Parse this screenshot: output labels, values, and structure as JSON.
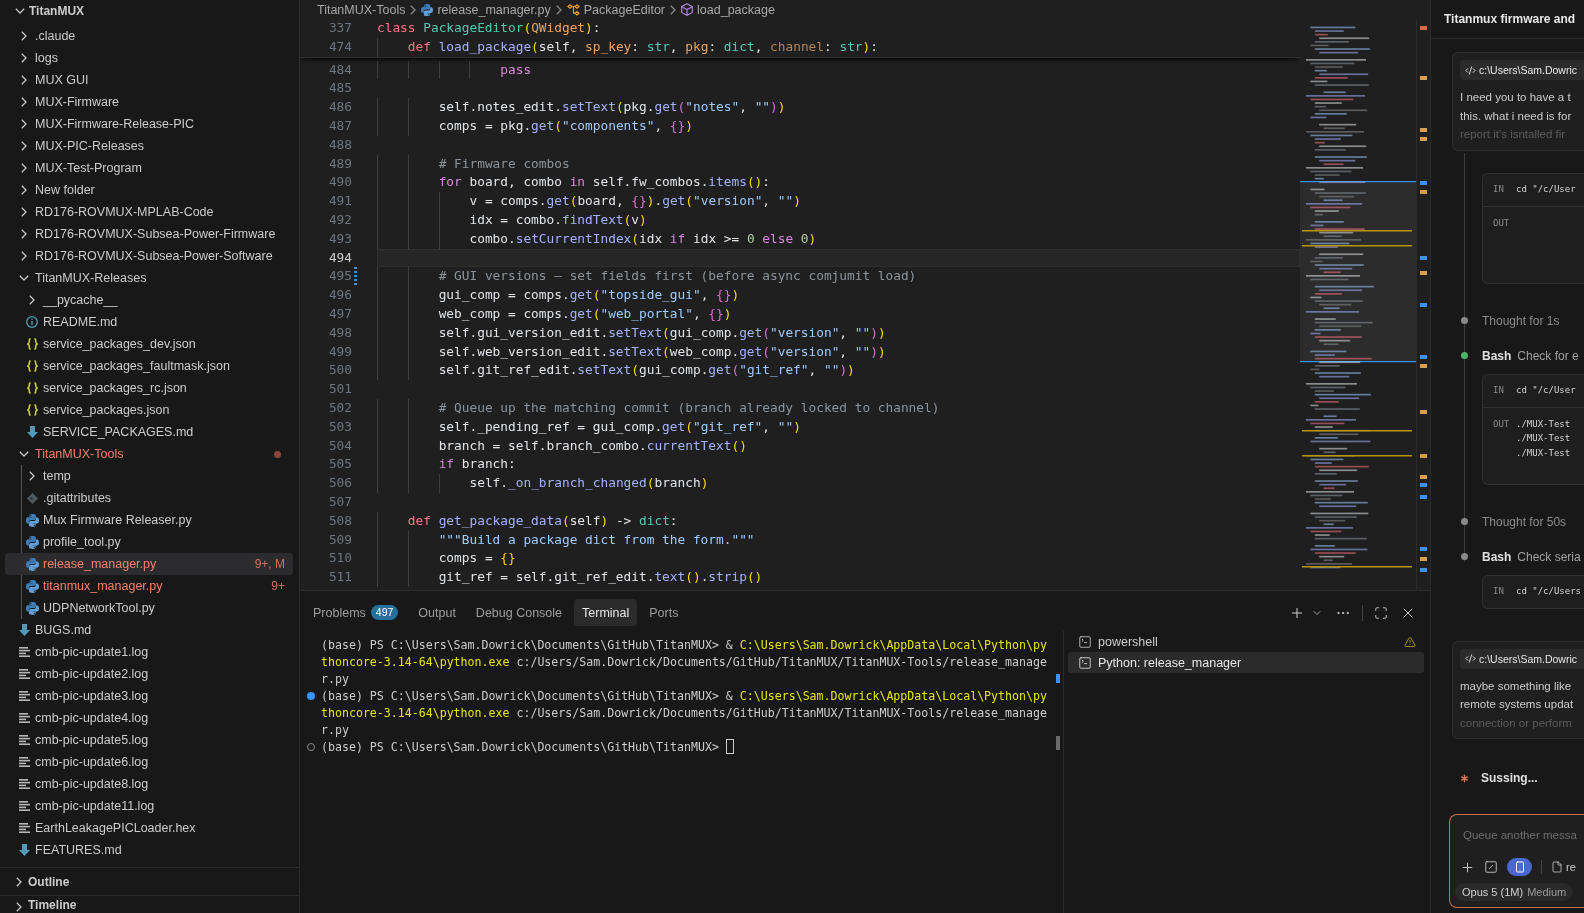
{
  "explorer": {
    "root": {
      "label": "TitanMUX",
      "expanded": true,
      "children": [
        {
          "label": ".claude",
          "kind": "folder",
          "expanded": false,
          "selected": false,
          "problem": false,
          "dot": false
        },
        {
          "label": "logs",
          "kind": "folder",
          "expanded": false,
          "selected": false,
          "problem": false,
          "dot": false
        },
        {
          "label": "MUX GUI",
          "kind": "folder",
          "expanded": false,
          "selected": false,
          "problem": false,
          "dot": false
        },
        {
          "label": "MUX-Firmware",
          "kind": "folder",
          "expanded": false,
          "selected": false,
          "problem": false,
          "dot": false
        },
        {
          "label": "MUX-Firmware-Release-PIC",
          "kind": "folder",
          "expanded": false,
          "selected": false,
          "problem": false,
          "dot": false
        },
        {
          "label": "MUX-PIC-Releases",
          "kind": "folder",
          "expanded": false,
          "selected": false,
          "problem": false,
          "dot": false
        },
        {
          "label": "MUX-Test-Program",
          "kind": "folder",
          "expanded": false,
          "selected": false,
          "problem": false,
          "dot": false
        },
        {
          "label": "New folder",
          "kind": "folder",
          "expanded": false,
          "selected": false,
          "problem": false,
          "dot": false
        },
        {
          "label": "RD176-ROVMUX-MPLAB-Code",
          "kind": "folder",
          "expanded": false,
          "selected": false,
          "problem": false,
          "dot": false
        },
        {
          "label": "RD176-ROVMUX-Subsea-Power-Firmware",
          "kind": "folder",
          "expanded": false,
          "selected": false,
          "problem": false,
          "dot": false
        },
        {
          "label": "RD176-ROVMUX-Subsea-Power-Software",
          "kind": "folder",
          "expanded": false,
          "selected": false,
          "problem": false,
          "dot": false
        },
        {
          "label": "TitanMUX-Releases",
          "kind": "folder",
          "expanded": true,
          "selected": false,
          "problem": false,
          "dot": false,
          "children": [
            {
              "label": "__pycache__",
              "kind": "folder",
              "expanded": false,
              "selected": false,
              "problem": false,
              "dot": false
            },
            {
              "label": "README.md",
              "kind": "readme",
              "selected": false,
              "problem": false
            },
            {
              "label": "service_packages_dev.json",
              "kind": "json",
              "selected": false,
              "problem": false
            },
            {
              "label": "service_packages_faultmask.json",
              "kind": "json",
              "selected": false,
              "problem": false
            },
            {
              "label": "service_packages_rc.json",
              "kind": "json",
              "selected": false,
              "problem": false
            },
            {
              "label": "service_packages.json",
              "kind": "json",
              "selected": false,
              "problem": false
            },
            {
              "label": "SERVICE_PACKAGES.md",
              "kind": "markdown",
              "selected": false,
              "problem": false
            }
          ]
        },
        {
          "label": "TitanMUX-Tools",
          "kind": "folder",
          "expanded": true,
          "selected": false,
          "problem": true,
          "dot": true,
          "children": [
            {
              "label": "temp",
              "kind": "folder",
              "expanded": false,
              "selected": false,
              "problem": false,
              "dot": false
            },
            {
              "label": ".gitattributes",
              "kind": "git",
              "selected": false,
              "problem": false
            },
            {
              "label": "Mux Firmware Releaser.py",
              "kind": "python",
              "selected": false,
              "problem": false
            },
            {
              "label": "profile_tool.py",
              "kind": "python",
              "selected": false,
              "problem": false
            },
            {
              "label": "release_manager.py",
              "kind": "python",
              "selected": true,
              "problem": true,
              "badge": "9+, M"
            },
            {
              "label": "titanmux_manager.py",
              "kind": "python",
              "selected": false,
              "problem": true,
              "badge": "9+"
            },
            {
              "label": "UDPNetworkTool.py",
              "kind": "python",
              "selected": false,
              "problem": false
            }
          ]
        },
        {
          "label": "BUGS.md",
          "kind": "markdown",
          "selected": false,
          "problem": false
        },
        {
          "label": "cmb-pic-update1.log",
          "kind": "text",
          "selected": false,
          "problem": false
        },
        {
          "label": "cmb-pic-update2.log",
          "kind": "text",
          "selected": false,
          "problem": false
        },
        {
          "label": "cmb-pic-update3.log",
          "kind": "text",
          "selected": false,
          "problem": false
        },
        {
          "label": "cmb-pic-update4.log",
          "kind": "text",
          "selected": false,
          "problem": false
        },
        {
          "label": "cmb-pic-update5.log",
          "kind": "text",
          "selected": false,
          "problem": false
        },
        {
          "label": "cmb-pic-update6.log",
          "kind": "text",
          "selected": false,
          "problem": false
        },
        {
          "label": "cmb-pic-update8.log",
          "kind": "text",
          "selected": false,
          "problem": false
        },
        {
          "label": "cmb-pic-update11.log",
          "kind": "text",
          "selected": false,
          "problem": false
        },
        {
          "label": "EarthLeakagePICLoader.hex",
          "kind": "text",
          "selected": false,
          "problem": false
        },
        {
          "label": "FEATURES.md",
          "kind": "markdown",
          "selected": false,
          "problem": false
        }
      ]
    },
    "sections": [
      {
        "label": "Outline",
        "expanded": false
      },
      {
        "label": "Timeline",
        "expanded": false
      }
    ]
  },
  "editor": {
    "breadcrumbs": [
      {
        "label": "TitanMUX-Tools",
        "kind": "folder"
      },
      {
        "label": "release_manager.py",
        "kind": "python"
      },
      {
        "label": "PackageEditor",
        "kind": "class"
      },
      {
        "label": "load_package",
        "kind": "method"
      }
    ],
    "sticky_lines": [
      {
        "number": "337",
        "tokens": [
          {
            "kind": "keyword",
            "text": "class "
          },
          {
            "kind": "class-name",
            "text": "PackageEditor"
          },
          {
            "kind": "bracket-1",
            "text": "("
          },
          {
            "kind": "base-class",
            "text": "QWidget"
          },
          {
            "kind": "bracket-1",
            "text": ")"
          },
          {
            "kind": "plain",
            "text": ":"
          }
        ]
      },
      {
        "number": "474",
        "tokens": [
          {
            "kind": "keyword",
            "text": "    def "
          },
          {
            "kind": "function",
            "text": "load_package"
          },
          {
            "kind": "bracket-1",
            "text": "("
          },
          {
            "kind": "plain",
            "text": "self, "
          },
          {
            "kind": "parameter",
            "text": "sp_key"
          },
          {
            "kind": "plain",
            "text": ": "
          },
          {
            "kind": "type",
            "text": "str"
          },
          {
            "kind": "plain",
            "text": ", "
          },
          {
            "kind": "parameter",
            "text": "pkg"
          },
          {
            "kind": "plain",
            "text": ": "
          },
          {
            "kind": "type",
            "text": "dict"
          },
          {
            "kind": "plain",
            "text": ", "
          },
          {
            "kind": "unused-parameter",
            "text": "channel"
          },
          {
            "kind": "plain",
            "text": ": "
          },
          {
            "kind": "type",
            "text": "str"
          },
          {
            "kind": "bracket-1",
            "text": ")"
          },
          {
            "kind": "plain",
            "text": ":"
          }
        ]
      }
    ],
    "lines": [
      {
        "number": "484",
        "current": false,
        "changed": false,
        "tokens": [
          {
            "kind": "control",
            "text": "                pass"
          }
        ]
      },
      {
        "number": "485",
        "current": false,
        "changed": false
      },
      {
        "number": "486",
        "current": false,
        "changed": false,
        "tokens": [
          {
            "kind": "plain",
            "text": "        self.notes_edit."
          },
          {
            "kind": "function",
            "text": "setText"
          },
          {
            "kind": "bracket-1",
            "text": "("
          },
          {
            "kind": "plain",
            "text": "pkg."
          },
          {
            "kind": "function",
            "text": "get"
          },
          {
            "kind": "bracket-2",
            "text": "("
          },
          {
            "kind": "string",
            "text": "\"notes\""
          },
          {
            "kind": "plain",
            "text": ", "
          },
          {
            "kind": "string",
            "text": "\"\""
          },
          {
            "kind": "bracket-2",
            "text": ")"
          },
          {
            "kind": "bracket-1",
            "text": ")"
          }
        ]
      },
      {
        "number": "487",
        "current": false,
        "changed": false,
        "tokens": [
          {
            "kind": "plain",
            "text": "        comps = pkg."
          },
          {
            "kind": "function",
            "text": "get"
          },
          {
            "kind": "bracket-1",
            "text": "("
          },
          {
            "kind": "string",
            "text": "\"components\""
          },
          {
            "kind": "plain",
            "text": ", "
          },
          {
            "kind": "bracket-2",
            "text": "{}"
          },
          {
            "kind": "bracket-1",
            "text": ")"
          }
        ]
      },
      {
        "number": "488",
        "current": false,
        "changed": false
      },
      {
        "number": "489",
        "current": false,
        "changed": false,
        "tokens": [
          {
            "kind": "comment",
            "text": "        # Firmware combos"
          }
        ]
      },
      {
        "number": "490",
        "current": false,
        "changed": false,
        "tokens": [
          {
            "kind": "control",
            "text": "        for"
          },
          {
            "kind": "plain",
            "text": " board, combo "
          },
          {
            "kind": "control",
            "text": "in"
          },
          {
            "kind": "plain",
            "text": " self.fw_combos."
          },
          {
            "kind": "function",
            "text": "items"
          },
          {
            "kind": "bracket-1",
            "text": "()"
          },
          {
            "kind": "plain",
            "text": ":"
          }
        ]
      },
      {
        "number": "491",
        "current": false,
        "changed": false,
        "tokens": [
          {
            "kind": "plain",
            "text": "            v = comps."
          },
          {
            "kind": "function",
            "text": "get"
          },
          {
            "kind": "bracket-1",
            "text": "("
          },
          {
            "kind": "plain",
            "text": "board, "
          },
          {
            "kind": "bracket-2",
            "text": "{}"
          },
          {
            "kind": "bracket-1",
            "text": ")"
          },
          {
            "kind": "plain",
            "text": "."
          },
          {
            "kind": "function",
            "text": "get"
          },
          {
            "kind": "bracket-1",
            "text": "("
          },
          {
            "kind": "string",
            "text": "\"version\""
          },
          {
            "kind": "plain",
            "text": ", "
          },
          {
            "kind": "string",
            "text": "\"\""
          },
          {
            "kind": "bracket-1",
            "text": ")"
          }
        ]
      },
      {
        "number": "492",
        "current": false,
        "changed": false,
        "tokens": [
          {
            "kind": "plain",
            "text": "            idx = combo."
          },
          {
            "kind": "function",
            "text": "findText"
          },
          {
            "kind": "bracket-1",
            "text": "("
          },
          {
            "kind": "plain",
            "text": "v"
          },
          {
            "kind": "bracket-1",
            "text": ")"
          }
        ]
      },
      {
        "number": "493",
        "current": false,
        "changed": false,
        "tokens": [
          {
            "kind": "plain",
            "text": "            combo."
          },
          {
            "kind": "function",
            "text": "setCurrentIndex"
          },
          {
            "kind": "bracket-1",
            "text": "("
          },
          {
            "kind": "plain",
            "text": "idx "
          },
          {
            "kind": "control",
            "text": "if"
          },
          {
            "kind": "plain",
            "text": " idx >= "
          },
          {
            "kind": "number",
            "text": "0 "
          },
          {
            "kind": "control",
            "text": "else "
          },
          {
            "kind": "number",
            "text": "0"
          },
          {
            "kind": "bracket-1",
            "text": ")"
          }
        ]
      },
      {
        "number": "494",
        "current": true,
        "changed": false
      },
      {
        "number": "495",
        "current": false,
        "changed": true,
        "tokens": [
          {
            "kind": "comment",
            "text": "        # GUI versions — set fields first (before async comjumit load)"
          }
        ]
      },
      {
        "number": "496",
        "current": false,
        "changed": false,
        "tokens": [
          {
            "kind": "plain",
            "text": "        gui_comp = comps."
          },
          {
            "kind": "function",
            "text": "get"
          },
          {
            "kind": "bracket-1",
            "text": "("
          },
          {
            "kind": "string",
            "text": "\"topside_gui\""
          },
          {
            "kind": "plain",
            "text": ", "
          },
          {
            "kind": "bracket-2",
            "text": "{}"
          },
          {
            "kind": "bracket-1",
            "text": ")"
          }
        ]
      },
      {
        "number": "497",
        "current": false,
        "changed": false,
        "tokens": [
          {
            "kind": "plain",
            "text": "        web_comp = comps."
          },
          {
            "kind": "function",
            "text": "get"
          },
          {
            "kind": "bracket-1",
            "text": "("
          },
          {
            "kind": "string",
            "text": "\"web_portal\""
          },
          {
            "kind": "plain",
            "text": ", "
          },
          {
            "kind": "bracket-2",
            "text": "{}"
          },
          {
            "kind": "bracket-1",
            "text": ")"
          }
        ]
      },
      {
        "number": "498",
        "current": false,
        "changed": false,
        "tokens": [
          {
            "kind": "plain",
            "text": "        self.gui_version_edit."
          },
          {
            "kind": "function",
            "text": "setText"
          },
          {
            "kind": "bracket-1",
            "text": "("
          },
          {
            "kind": "plain",
            "text": "gui_comp."
          },
          {
            "kind": "function",
            "text": "get"
          },
          {
            "kind": "bracket-2",
            "text": "("
          },
          {
            "kind": "string",
            "text": "\"version\""
          },
          {
            "kind": "plain",
            "text": ", "
          },
          {
            "kind": "string",
            "text": "\"\""
          },
          {
            "kind": "bracket-2",
            "text": ")"
          },
          {
            "kind": "bracket-1",
            "text": ")"
          }
        ]
      },
      {
        "number": "499",
        "current": false,
        "changed": false,
        "tokens": [
          {
            "kind": "plain",
            "text": "        self.web_version_edit."
          },
          {
            "kind": "function",
            "text": "setText"
          },
          {
            "kind": "bracket-1",
            "text": "("
          },
          {
            "kind": "plain",
            "text": "web_comp."
          },
          {
            "kind": "function",
            "text": "get"
          },
          {
            "kind": "bracket-2",
            "text": "("
          },
          {
            "kind": "string",
            "text": "\"version\""
          },
          {
            "kind": "plain",
            "text": ", "
          },
          {
            "kind": "string",
            "text": "\"\""
          },
          {
            "kind": "bracket-2",
            "text": ")"
          },
          {
            "kind": "bracket-1",
            "text": ")"
          }
        ]
      },
      {
        "number": "500",
        "current": false,
        "changed": false,
        "tokens": [
          {
            "kind": "plain",
            "text": "        self.git_ref_edit."
          },
          {
            "kind": "function",
            "text": "setText"
          },
          {
            "kind": "bracket-1",
            "text": "("
          },
          {
            "kind": "plain",
            "text": "gui_comp."
          },
          {
            "kind": "function",
            "text": "get"
          },
          {
            "kind": "bracket-2",
            "text": "("
          },
          {
            "kind": "string",
            "text": "\"git_ref\""
          },
          {
            "kind": "plain",
            "text": ", "
          },
          {
            "kind": "string",
            "text": "\"\""
          },
          {
            "kind": "bracket-2",
            "text": ")"
          },
          {
            "kind": "bracket-1",
            "text": ")"
          }
        ]
      },
      {
        "number": "501",
        "current": false,
        "changed": false
      },
      {
        "number": "502",
        "current": false,
        "changed": false,
        "tokens": [
          {
            "kind": "comment",
            "text": "        # Queue up the matching commit (branch already locked to channel)"
          }
        ]
      },
      {
        "number": "503",
        "current": false,
        "changed": false,
        "tokens": [
          {
            "kind": "plain",
            "text": "        self._pending_ref = gui_comp."
          },
          {
            "kind": "function",
            "text": "get"
          },
          {
            "kind": "bracket-1",
            "text": "("
          },
          {
            "kind": "string",
            "text": "\"git_ref\""
          },
          {
            "kind": "plain",
            "text": ", "
          },
          {
            "kind": "string",
            "text": "\"\""
          },
          {
            "kind": "bracket-1",
            "text": ")"
          }
        ]
      },
      {
        "number": "504",
        "current": false,
        "changed": false,
        "tokens": [
          {
            "kind": "plain",
            "text": "        branch = self.branch_combo."
          },
          {
            "kind": "function",
            "text": "currentText"
          },
          {
            "kind": "bracket-1",
            "text": "()"
          }
        ]
      },
      {
        "number": "505",
        "current": false,
        "changed": false,
        "tokens": [
          {
            "kind": "control",
            "text": "        if"
          },
          {
            "kind": "plain",
            "text": " branch:"
          }
        ]
      },
      {
        "number": "506",
        "current": false,
        "changed": false,
        "tokens": [
          {
            "kind": "plain",
            "text": "            self."
          },
          {
            "kind": "function",
            "text": "_on_branch_changed"
          },
          {
            "kind": "bracket-1",
            "text": "("
          },
          {
            "kind": "plain",
            "text": "branch"
          },
          {
            "kind": "bracket-1",
            "text": ")"
          }
        ]
      },
      {
        "number": "507",
        "current": false,
        "changed": false
      },
      {
        "number": "508",
        "current": false,
        "changed": false,
        "tokens": [
          {
            "kind": "keyword",
            "text": "    def "
          },
          {
            "kind": "function",
            "text": "get_package_data"
          },
          {
            "kind": "bracket-1",
            "text": "("
          },
          {
            "kind": "plain",
            "text": "self"
          },
          {
            "kind": "bracket-1",
            "text": ")"
          },
          {
            "kind": "plain",
            "text": " -> "
          },
          {
            "kind": "type",
            "text": "dict"
          },
          {
            "kind": "plain",
            "text": ":"
          }
        ]
      },
      {
        "number": "509",
        "current": false,
        "changed": false,
        "tokens": [
          {
            "kind": "string",
            "text": "        \"\"\"Build a package dict from the form.\"\"\""
          }
        ]
      },
      {
        "number": "510",
        "current": false,
        "changed": false,
        "tokens": [
          {
            "kind": "plain",
            "text": "        comps = "
          },
          {
            "kind": "bracket-1",
            "text": "{}"
          }
        ]
      },
      {
        "number": "511",
        "current": false,
        "changed": false,
        "tokens": [
          {
            "kind": "plain",
            "text": "        git_ref = self.git_ref_edit."
          },
          {
            "kind": "function",
            "text": "text"
          },
          {
            "kind": "bracket-1",
            "text": "()"
          },
          {
            "kind": "plain",
            "text": "."
          },
          {
            "kind": "function",
            "text": "strip"
          },
          {
            "kind": "bracket-1",
            "text": "()"
          }
        ]
      }
    ]
  },
  "panel": {
    "tabs": [
      {
        "label": "Problems",
        "badge": "497",
        "selected": false
      },
      {
        "label": "Output",
        "selected": false
      },
      {
        "label": "Debug Console",
        "selected": false
      },
      {
        "label": "Terminal",
        "selected": true
      },
      {
        "label": "Ports",
        "selected": false
      }
    ],
    "terminal_lines": [
      {
        "kind": "plain",
        "cursor": false,
        "segments": [
          {
            "kind": "plain",
            "text": "(base) PS C:\\Users\\Sam.Dowrick\\Documents\\GitHub\\TitanMUX> & "
          },
          {
            "kind": "path",
            "text": "C:\\Users\\Sam.Dowrick\\AppData\\Local\\Python\\py"
          }
        ]
      },
      {
        "kind": "plain",
        "cursor": false,
        "segments": [
          {
            "kind": "path",
            "text": "thoncore-3.14-64\\python.exe"
          },
          {
            "kind": "plain",
            "text": " c:/Users/Sam.Dowrick/Documents/GitHub/TitanMUX/TitanMUX-Tools/release_manage"
          }
        ]
      },
      {
        "kind": "plain",
        "cursor": false,
        "segments": [
          {
            "kind": "plain",
            "text": "r.py"
          }
        ]
      },
      {
        "kind": "success",
        "cursor": false,
        "segments": [
          {
            "kind": "plain",
            "text": "(base) PS C:\\Users\\Sam.Dowrick\\Documents\\GitHub\\TitanMUX> & "
          },
          {
            "kind": "path",
            "text": "C:\\Users\\Sam.Dowrick\\AppData\\Local\\Python\\py"
          }
        ]
      },
      {
        "kind": "plain",
        "cursor": false,
        "segments": [
          {
            "kind": "path",
            "text": "thoncore-3.14-64\\python.exe"
          },
          {
            "kind": "plain",
            "text": " c:/Users/Sam.Dowrick/Documents/GitHub/TitanMUX/TitanMUX-Tools/release_manage"
          }
        ]
      },
      {
        "kind": "plain",
        "cursor": false,
        "segments": [
          {
            "kind": "plain",
            "text": "r.py"
          }
        ]
      },
      {
        "kind": "pending",
        "cursor": true,
        "segments": [
          {
            "kind": "plain",
            "text": "(base) PS C:\\Users\\Sam.Dowrick\\Documents\\GitHub\\TitanMUX>"
          }
        ]
      }
    ],
    "terminals": [
      {
        "label": "powershell",
        "selected": false,
        "warning": true
      },
      {
        "label": "Python: release_manager",
        "selected": true,
        "warning": false
      }
    ]
  },
  "chat": {
    "title": "Titanmux firmware and",
    "turns": [
      {
        "kind": "user",
        "path": "c:\\Users\\Sam.Dowric",
        "lines": [
          "I need you to have a t",
          "this. what i need is for",
          "report it's isntalled fir"
        ],
        "collapsed": true
      },
      {
        "kind": "steps",
        "steps": [
          {
            "kind": "block",
            "rows": [
              {
                "kind": "input",
                "label": "IN",
                "text": "cd \"/c/User"
              },
              {
                "kind": "output",
                "label": "OUT"
              }
            ]
          },
          {
            "kind": "thought",
            "label": "Thought for 1s",
            "color": "#8a8a8a"
          },
          {
            "kind": "tool",
            "name": "Bash",
            "description": "Check for e",
            "color": "#4cb464",
            "rows": [
              {
                "kind": "input",
                "label": "IN",
                "text": "cd \"/c/User"
              },
              {
                "kind": "output",
                "label": "OUT",
                "lines": [
                  "./MUX-Test",
                  "./MUX-Test",
                  "./MUX-Test"
                ]
              }
            ]
          },
          {
            "kind": "thought",
            "label": "Thought for 50s",
            "color": "#8a8a8a"
          },
          {
            "kind": "tool",
            "name": "Bash",
            "description": "Check seria",
            "color": "#8a8a8a",
            "rows": [
              {
                "kind": "input",
                "label": "IN",
                "text": "cd \"/c/Users"
              }
            ]
          }
        ]
      },
      {
        "kind": "user",
        "path": "c:\\Users\\Sam.Dowric",
        "lines": [
          "maybe something like",
          "remote systems updat",
          "connection or perform"
        ],
        "collapsed": true
      },
      {
        "kind": "status",
        "text": "Sussing..."
      }
    ],
    "composer": {
      "placeholder": "Queue another messa",
      "toggle_on": true,
      "attachment": "re",
      "model": "Opus 5 (1M)",
      "effort": "Medium"
    }
  }
}
